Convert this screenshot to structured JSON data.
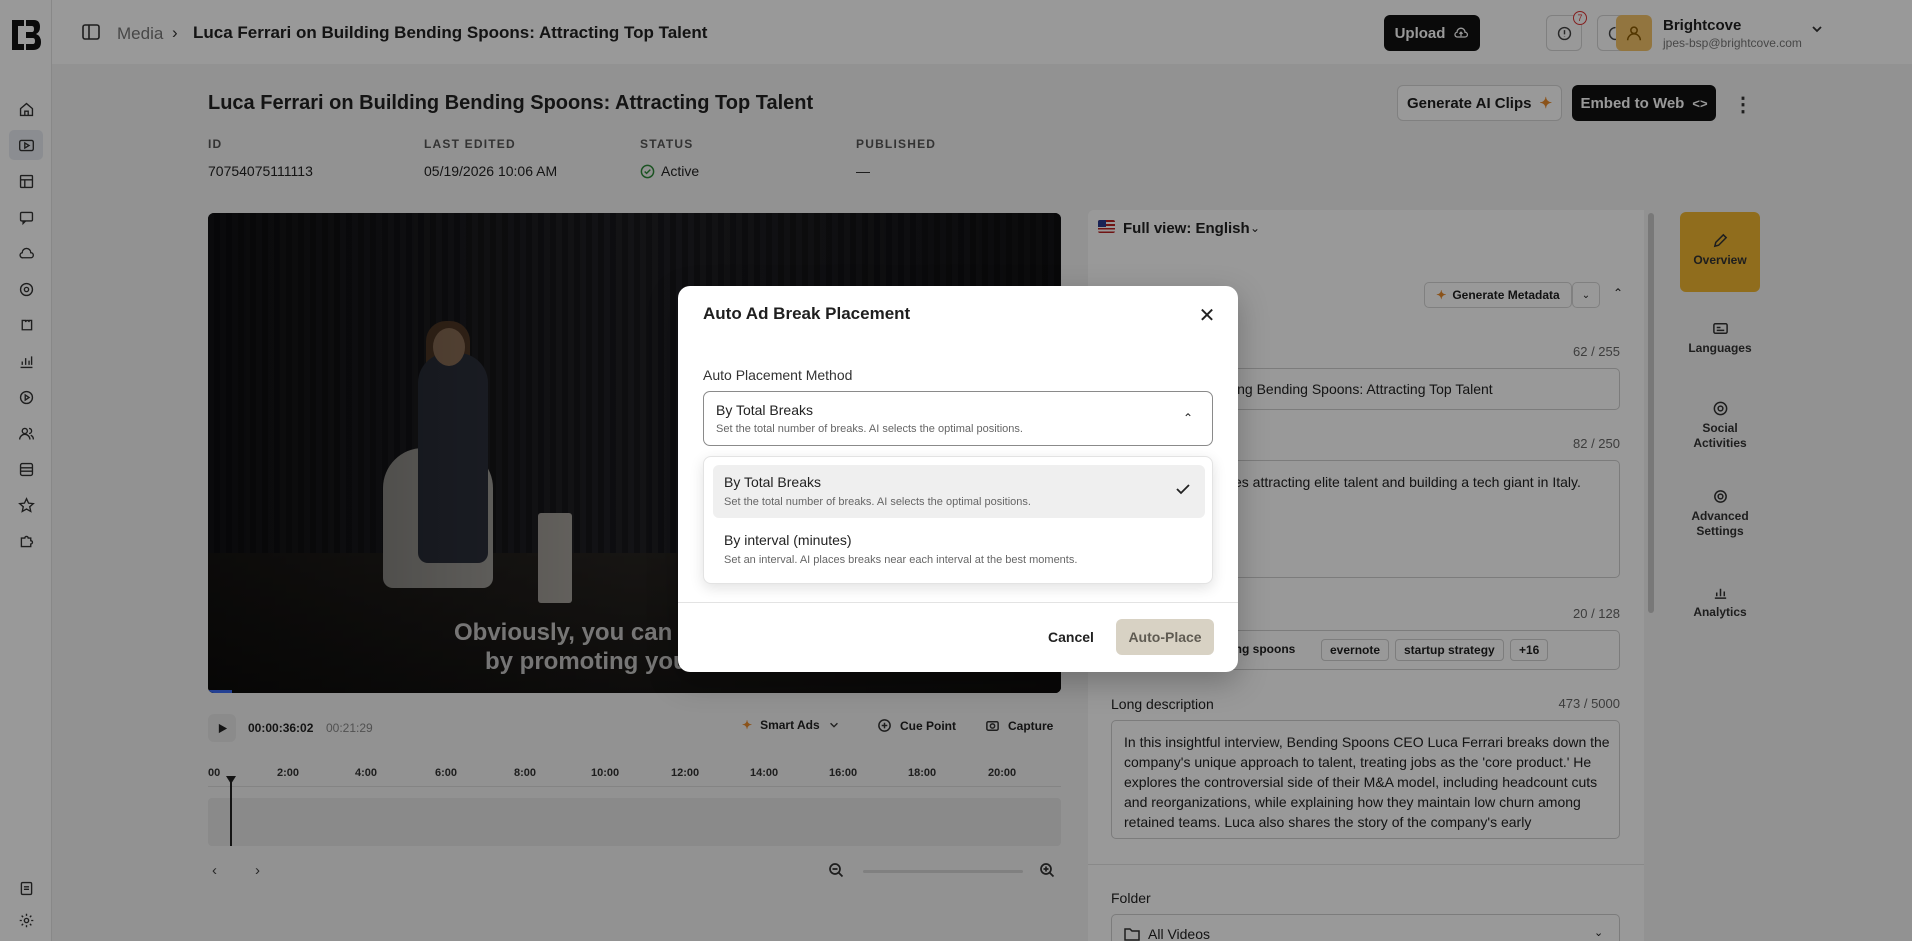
{
  "header": {
    "breadcrumb_root": "Media",
    "breadcrumb_sep": "›",
    "breadcrumb_current": "Luca Ferrari on Building Bending Spoons: Attracting Top Talent",
    "upload_label": "Upload",
    "notification_count": "7",
    "account_name": "Brightcove",
    "account_email": "jpes-bsp@brightcove.com"
  },
  "page": {
    "title": "Luca Ferrari on Building Bending Spoons: Attracting Top Talent",
    "generate_clips_label": "Generate AI Clips",
    "embed_label": "Embed to Web",
    "meta": [
      {
        "label": "ID",
        "value": "70754075111113"
      },
      {
        "label": "LAST EDITED",
        "value": "05/19/2026 10:06 AM"
      },
      {
        "label": "STATUS",
        "value": "Active"
      },
      {
        "label": "PUBLISHED",
        "value": "—"
      }
    ]
  },
  "player": {
    "caption_line1": "Obviously, you can ac",
    "caption_line2": "by promoting your",
    "current_time": "00:00:36:02",
    "duration": "00:21:29",
    "smart_ads_label": "Smart Ads",
    "cue_point_label": "Cue Point",
    "capture_label": "Capture",
    "timeline_ticks": [
      "00",
      "2:00",
      "4:00",
      "6:00",
      "8:00",
      "10:00",
      "12:00",
      "14:00",
      "16:00",
      "18:00",
      "20:00"
    ],
    "progress_fraction": 0.028
  },
  "metadata": {
    "view_label": "Full view: English",
    "generate_metadata_label": "Generate Metadata",
    "name_count": "62 / 255",
    "name_value": "ilding Bending Spoons: Attracting Top Talent",
    "short_desc_count": "82 / 250",
    "short_desc_value": "sses attracting elite talent and building a tech giant in Italy.",
    "tags_count": "20 / 128",
    "tags": [
      "ding spoons",
      "evernote",
      "startup strategy",
      "+16"
    ],
    "long_desc_label": "Long description",
    "long_desc_count": "473 / 5000",
    "long_desc_value": "In this insightful interview, Bending Spoons CEO Luca Ferrari breaks down the company's unique approach to talent, treating jobs as the 'core product.' He explores the controversial side of their M&A model, including headcount cuts and reorganizations, while explaining how they maintain low churn among retained teams. Luca also shares the story of the company's early",
    "folder_label": "Folder",
    "folder_value": "All Videos"
  },
  "right_tabs": [
    {
      "label": "Overview",
      "icon": "pencil-icon"
    },
    {
      "label": "Languages",
      "icon": "languages-icon"
    },
    {
      "label": "Social Activities",
      "icon": "social-icon"
    },
    {
      "label": "Advanced Settings",
      "icon": "gear-icon"
    },
    {
      "label": "Analytics",
      "icon": "bar-chart-icon"
    }
  ],
  "modal": {
    "title": "Auto Ad Break Placement",
    "method_label": "Auto Placement Method",
    "selected_title": "By Total Breaks",
    "selected_sub": "Set the total number of breaks. AI selects the optimal positions.",
    "options": [
      {
        "title": "By Total Breaks",
        "sub": "Set the total number of breaks. AI selects the optimal positions."
      },
      {
        "title": "By interval (minutes)",
        "sub": "Set an interval. AI places breaks near each interval at the best moments."
      }
    ],
    "cancel_label": "Cancel",
    "confirm_label": "Auto-Place"
  }
}
